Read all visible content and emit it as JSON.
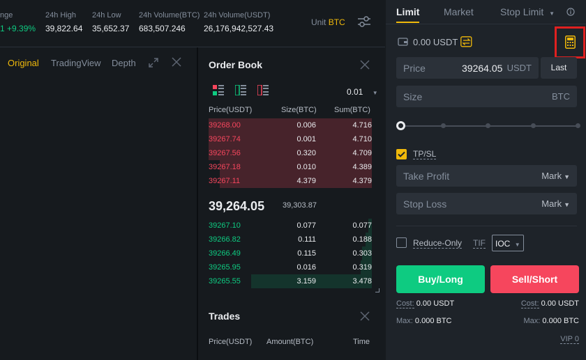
{
  "ticker": {
    "change_label": "nge",
    "change_value": "1 +9.39%",
    "high_label": "24h High",
    "high_value": "39,822.64",
    "low_label": "24h Low",
    "low_value": "35,652.37",
    "vol_btc_label": "24h Volume(BTC)",
    "vol_btc_value": "683,507.246",
    "vol_usdt_label": "24h Volume(USDT)",
    "vol_usdt_value": "26,176,942,527.43",
    "unit_label": "Unit",
    "unit_value": "BTC"
  },
  "chart_tabs": [
    "Original",
    "TradingView",
    "Depth"
  ],
  "orderbook": {
    "title": "Order Book",
    "precision": "0.01",
    "headers": {
      "price": "Price(USDT)",
      "size": "Size(BTC)",
      "sum": "Sum(BTC)"
    },
    "asks": [
      {
        "price": "39268.00",
        "size": "0.006",
        "sum": "4.716",
        "depth": 1.0
      },
      {
        "price": "39267.74",
        "size": "0.001",
        "sum": "4.710",
        "depth": 1.0
      },
      {
        "price": "39267.56",
        "size": "0.320",
        "sum": "4.709",
        "depth": 1.0
      },
      {
        "price": "39267.18",
        "size": "0.010",
        "sum": "4.389",
        "depth": 0.93
      },
      {
        "price": "39267.11",
        "size": "4.379",
        "sum": "4.379",
        "depth": 0.93
      }
    ],
    "mid_price": "39,264.05",
    "mark_price": "39,303.87",
    "bids": [
      {
        "price": "39267.10",
        "size": "0.077",
        "sum": "0.077",
        "depth": 0.02
      },
      {
        "price": "39266.82",
        "size": "0.111",
        "sum": "0.188",
        "depth": 0.04
      },
      {
        "price": "39266.49",
        "size": "0.115",
        "sum": "0.303",
        "depth": 0.06
      },
      {
        "price": "39265.95",
        "size": "0.016",
        "sum": "0.319",
        "depth": 0.07
      },
      {
        "price": "39265.55",
        "size": "3.159",
        "sum": "3.478",
        "depth": 0.74
      }
    ]
  },
  "trades": {
    "title": "Trades",
    "headers": {
      "price": "Price(USDT)",
      "amount": "Amount(BTC)",
      "time": "Time"
    }
  },
  "order_form": {
    "tabs": {
      "limit": "Limit",
      "market": "Market",
      "stop_limit": "Stop Limit"
    },
    "balance": "0.00 USDT",
    "price_label": "Price",
    "price_value": "39264.05",
    "price_unit": "USDT",
    "last_button": "Last",
    "size_label": "Size",
    "size_unit": "BTC",
    "tpsl_label": "TP/SL",
    "tpsl_checked": true,
    "take_profit_label": "Take Profit",
    "take_profit_mode": "Mark",
    "stop_loss_label": "Stop Loss",
    "stop_loss_mode": "Mark",
    "reduce_only_label": "Reduce-Only",
    "tif_label": "TIF",
    "tif_value": "IOC",
    "buy_label": "Buy/Long",
    "sell_label": "Sell/Short",
    "cost_label": "Cost:",
    "buy_cost": "0.00 USDT",
    "sell_cost": "0.00 USDT",
    "max_label": "Max:",
    "buy_max": "0.000 BTC",
    "sell_max": "0.000 BTC",
    "vip": "VIP 0"
  },
  "colors": {
    "accent": "#f0b90b",
    "buy": "#0ecb81",
    "sell": "#f6465d",
    "highlight": "#e02020"
  }
}
